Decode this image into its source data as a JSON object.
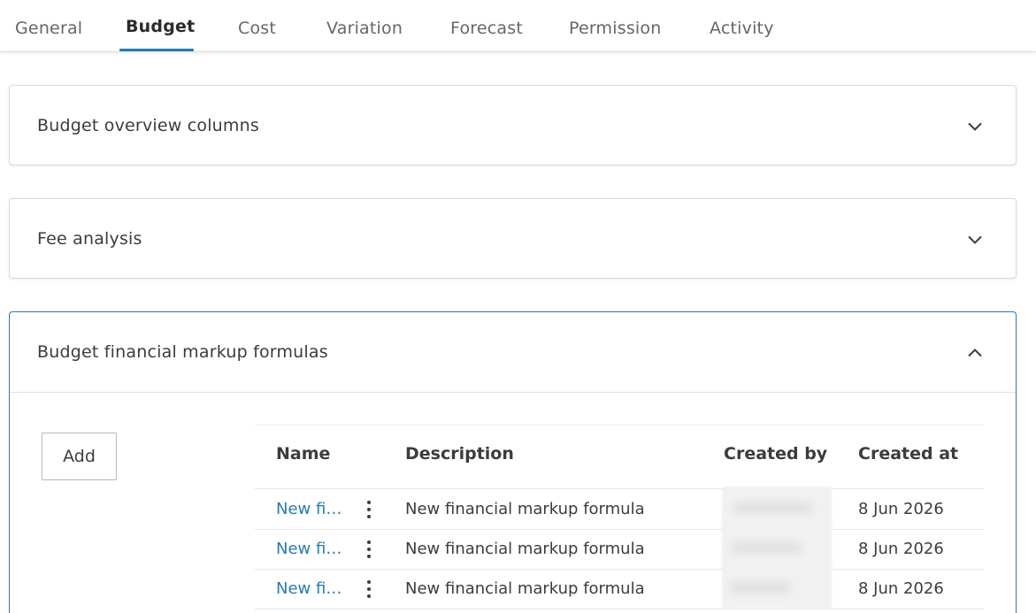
{
  "tabs": [
    {
      "label": "General"
    },
    {
      "label": "Budget"
    },
    {
      "label": "Cost"
    },
    {
      "label": "Variation"
    },
    {
      "label": "Forecast"
    },
    {
      "label": "Permission"
    },
    {
      "label": "Activity"
    }
  ],
  "active_tab": "Budget",
  "panels": {
    "overview": {
      "title": "Budget overview columns",
      "state": "collapsed",
      "icon": "chevron-down-icon"
    },
    "fee": {
      "title": "Fee analysis",
      "state": "collapsed",
      "icon": "chevron-down-icon"
    },
    "markup": {
      "title": "Budget financial markup formulas",
      "state": "expanded",
      "icon": "chevron-up-icon"
    }
  },
  "markup_table": {
    "add_label": "Add",
    "columns": [
      "Name",
      "Description",
      "Created by",
      "Created at"
    ],
    "rows": [
      {
        "name": "New fi…",
        "description": "New financial markup formula",
        "created_by": "",
        "created_at": "8 Jun 2026"
      },
      {
        "name": "New fi…",
        "description": "New financial markup formula",
        "created_by": "",
        "created_at": "8 Jun 2026"
      },
      {
        "name": "New fi…",
        "description": "New financial markup formula",
        "created_by": "",
        "created_at": "8 Jun 2026"
      }
    ]
  },
  "colors": {
    "accent": "#2a7ab0",
    "text": "#3c3c3c",
    "border": "#d9d9d9"
  }
}
